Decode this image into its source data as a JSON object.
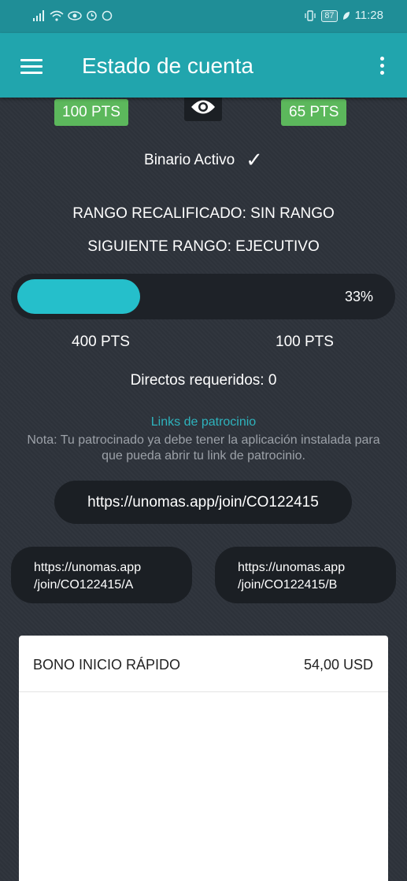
{
  "status_bar": {
    "time": "11:28",
    "battery": "87"
  },
  "app_bar": {
    "title": "Estado de cuenta"
  },
  "points": {
    "left": "100 PTS",
    "right": "65 PTS"
  },
  "binary": {
    "label": "Binario Activo"
  },
  "rank": {
    "recalified": "RANGO RECALIFICADO: SIN RANGO",
    "next": "SIGUIENTE RANGO: EJECUTIVO"
  },
  "progress": {
    "percent_label": "33%",
    "value": 0.33,
    "left_pts": "400 PTS",
    "right_pts": "100 PTS"
  },
  "directs": {
    "label": "Directos requeridos: 0"
  },
  "sponsor": {
    "title": "Links de patrocinio",
    "note": "Nota: Tu patrocinado ya debe tener la aplicación instalada para que pueda abrir tu link de patrocinio.",
    "main_link": "https://unomas.app/join/CO122415",
    "link_a_line1": "https://unomas.app",
    "link_a_line2": "/join/CO122415/A",
    "link_b_line1": "https://unomas.app",
    "link_b_line2": "/join/CO122415/B"
  },
  "bonus_card": {
    "title": "BONO INICIO RÁPIDO",
    "amount": "54,00 USD"
  },
  "colors": {
    "accent": "#21a5ad",
    "progress": "#25bfcb",
    "badge": "#5cb85c",
    "background": "#2e333b"
  }
}
